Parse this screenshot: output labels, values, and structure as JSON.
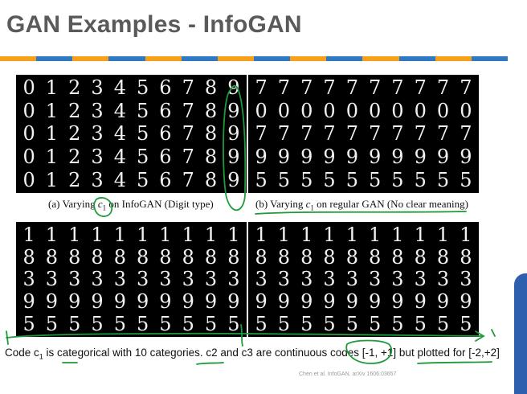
{
  "slide": {
    "title": "GAN Examples - InfoGAN",
    "stripe_colors": [
      "#f6a01a",
      "#2f79c2",
      "#f6a01a",
      "#2f79c2",
      "#f6a01a",
      "#2f79c2",
      "#f6a01a",
      "#2f79c2",
      "#f6a01a",
      "#2f79c2",
      "#f6a01a",
      "#2f79c2",
      "#f6a01a",
      "#2f79c2"
    ],
    "caption_a": {
      "pre": "(a) Varying ",
      "var": "c",
      "sub": "1",
      "post": " on InfoGAN (Digit type)"
    },
    "caption_b": {
      "pre": "(b) Varying ",
      "var": "c",
      "sub": "1",
      "post": " on regular GAN (No clear meaning)"
    },
    "bottom_text": {
      "p1": "Code c",
      "sub": "1",
      "p2": " is categorical with 10 categories. c2 and c3 are continuous codes [-1, +1] but plotted for [-2,+2]"
    },
    "footer": "Chen et al. InfoGAN. arXiv 1606.03657"
  },
  "panels": {
    "top_left": [
      "0123456789",
      "0123456789",
      "0123456789",
      "0123456789",
      "0123456789"
    ],
    "top_right": [
      "7777777777",
      "0000000000",
      "7777777777",
      "9999999999",
      "5555555555"
    ],
    "bottom_left": [
      "1111111111",
      "8888888888",
      "3333333333",
      "9999999999",
      "5555555555"
    ],
    "bottom_right": [
      "1111111111",
      "8888888888",
      "3333333333",
      "9999999999",
      "5555555555"
    ]
  }
}
